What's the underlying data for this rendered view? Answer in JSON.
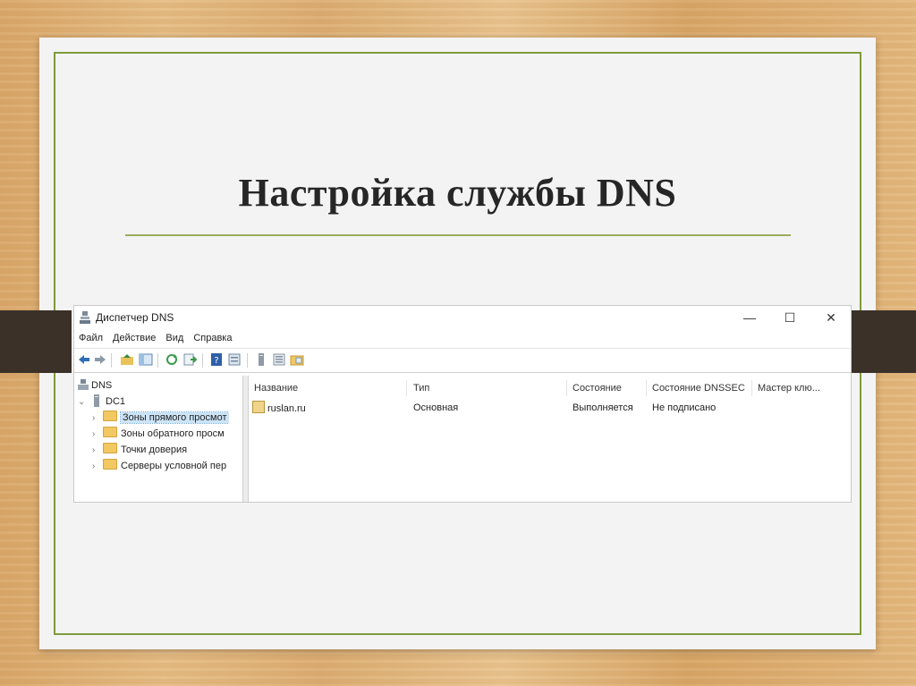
{
  "slide": {
    "title": "Настройка службы DNS"
  },
  "window": {
    "title": "Диспетчер DNS",
    "controls": {
      "minimize": "—",
      "maximize": "☐",
      "close": "✕"
    },
    "menu": [
      "Файл",
      "Действие",
      "Вид",
      "Справка"
    ],
    "tree": {
      "root": "DNS",
      "server": "DC1",
      "children": [
        "Зоны прямого просмот",
        "Зоны обратного просм",
        "Точки доверия",
        "Серверы условной пер"
      ]
    },
    "columns": [
      "Название",
      "Тип",
      "Состояние",
      "Состояние DNSSEC",
      "Мастер клю..."
    ],
    "rows": [
      {
        "name": "ruslan.ru",
        "type": "Основная",
        "status": "Выполняется",
        "dnssec": "Не подписано",
        "key_master": ""
      }
    ]
  },
  "colors": {
    "frame": "#7f9a3a",
    "band": "#3b3129",
    "selection": "#cce4f7"
  }
}
